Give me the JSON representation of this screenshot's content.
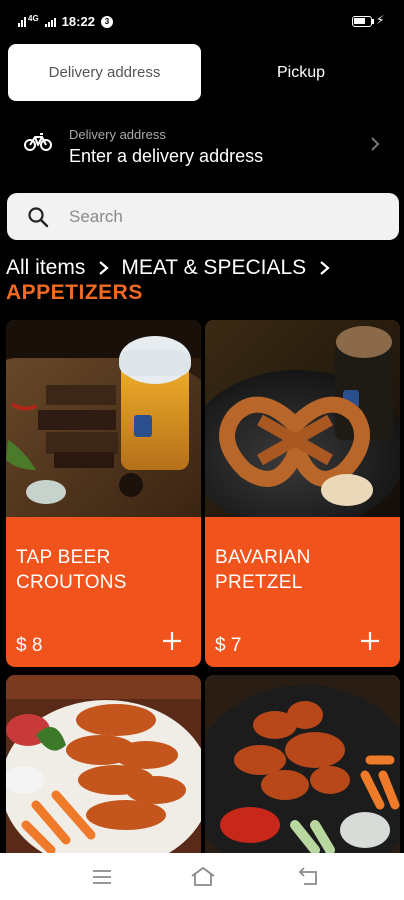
{
  "status_bar": {
    "network": "4G",
    "time": "18:22",
    "notification_badge": "3",
    "battery_label": "88"
  },
  "tabs": {
    "delivery_label": "Delivery address",
    "pickup_label": "Pickup"
  },
  "address": {
    "label": "Delivery address",
    "prompt": "Enter a delivery address",
    "icon": "bicycle-icon"
  },
  "search": {
    "placeholder": "Search",
    "value": ""
  },
  "breadcrumb": {
    "items": [
      "All items",
      "MEAT & SPECIALS"
    ],
    "current": "APPETIZERS"
  },
  "products": [
    {
      "name": "TAP BEER CROUTONS",
      "price": "$ 8",
      "image": "beer-croutons-photo"
    },
    {
      "name": "BAVARIAN PRETZEL",
      "price": "$ 7",
      "image": "pretzel-photo"
    },
    {
      "name": "",
      "price": "",
      "image": "chicken-wings-photo"
    },
    {
      "name": "",
      "price": "",
      "image": "buffalo-wings-photo"
    }
  ],
  "colors": {
    "accent": "#f26a21",
    "card": "#f0531c",
    "background": "#000000"
  }
}
